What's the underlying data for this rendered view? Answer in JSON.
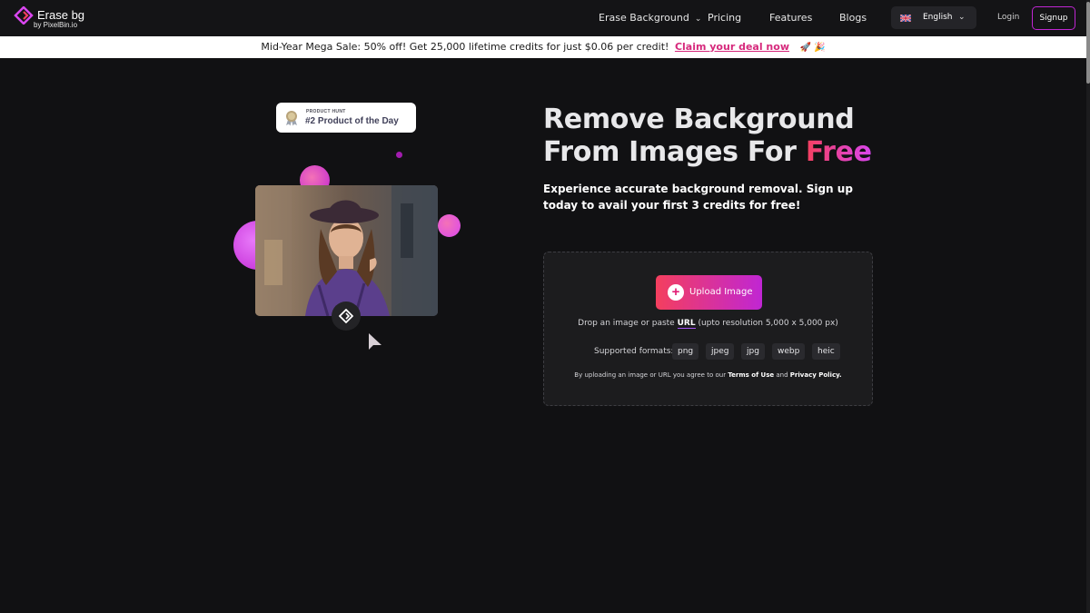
{
  "nav": {
    "logo_name": "Erase bg",
    "logo_sub": "by PixelBin.io",
    "links": [
      "Erase Background",
      "Pricing",
      "Features",
      "Blogs"
    ],
    "language": "English",
    "login": "Login",
    "signup": "Signup"
  },
  "banner": {
    "text": "Mid-Year Mega Sale: 50% off! Get 25,000 lifetime credits for just $0.06 per credit!",
    "cta": "Claim your deal now",
    "emoji": "🚀 🎉"
  },
  "badge": {
    "kicker": "PRODUCT HUNT",
    "rank": "#2 Product of the Day"
  },
  "hero": {
    "title_line1": "Remove Background",
    "title_line2": "From Images For",
    "title_accent": "Free",
    "subtitle": "Experience accurate background removal. Sign up today to avail your first 3 credits for free!"
  },
  "upload": {
    "button": "Upload Image",
    "hint_prefix": "Drop an image or paste",
    "hint_url": "URL",
    "hint_suffix": "(upto resolution 5,000 x 5,000 px)",
    "formats_label": "Supported formats:",
    "formats": [
      "png",
      "jpeg",
      "jpg",
      "webp",
      "heic"
    ],
    "terms_prefix": "By uploading an image or URL you agree to our",
    "terms_link": "Terms of Use",
    "terms_and": "and",
    "privacy_link": "Privacy Policy."
  },
  "colors": {
    "background": "#111113",
    "accent_start": "#f43f5e",
    "accent_end": "#c026d3"
  }
}
